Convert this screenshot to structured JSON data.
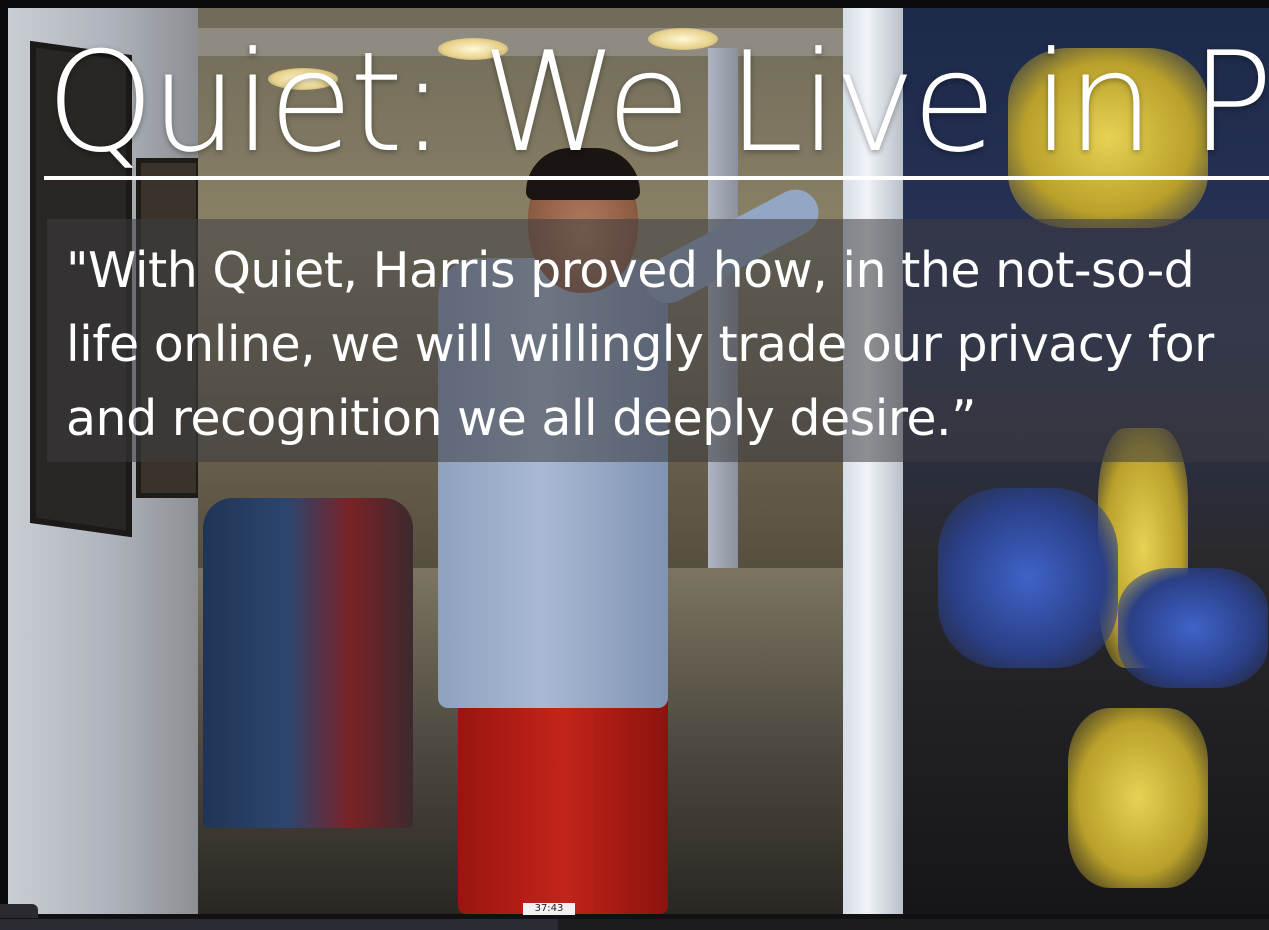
{
  "slide": {
    "title": "Quiet: We Live in Pu",
    "quote_lines": [
      "\"With Quiet, Harris proved how, in the not-so-d",
      "life online, we will willingly trade our privacy for",
      "and recognition we all deeply desire.”"
    ]
  },
  "player": {
    "time_tooltip": "37:43",
    "progress_fraction": 0.44
  },
  "colors": {
    "title_text": "#ffffff",
    "quote_box": "rgba(60,60,64,0.55)",
    "background": "#0b0b0d"
  },
  "icons": {
    "scrub_handle": "scrub-handle-icon"
  }
}
